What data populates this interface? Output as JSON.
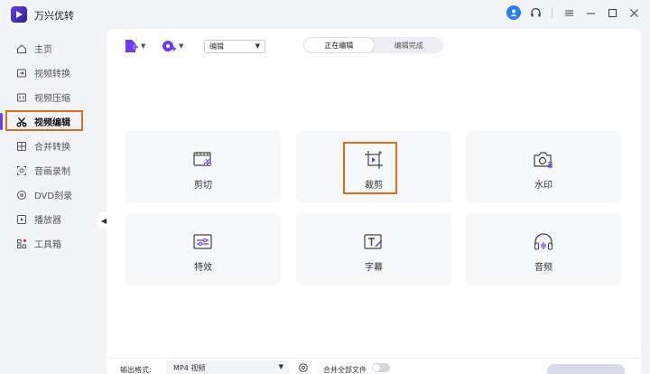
{
  "app": {
    "title": "万兴优转",
    "brand_color": "#6b3cf0",
    "icons": [
      "user-avatar-icon",
      "headset-icon",
      "menu-icon",
      "minimize-icon",
      "maximize-icon",
      "close-icon"
    ]
  },
  "sidebar": {
    "items": [
      {
        "label": "主页",
        "icon": "home-icon",
        "active": false
      },
      {
        "label": "视频转换",
        "icon": "convert-icon",
        "active": false
      },
      {
        "label": "视频压缩",
        "icon": "compress-icon",
        "active": false
      },
      {
        "label": "视频编辑",
        "icon": "scissors-icon",
        "active": true
      },
      {
        "label": "合并转换",
        "icon": "merge-icon",
        "active": false
      },
      {
        "label": "音画录制",
        "icon": "record-icon",
        "active": false
      },
      {
        "label": "DVD刻录",
        "icon": "disc-icon",
        "active": false
      },
      {
        "label": "播放器",
        "icon": "play-icon",
        "active": false
      },
      {
        "label": "工具箱",
        "icon": "toolbox-icon",
        "active": false
      }
    ],
    "highlight_color": "#d9701f"
  },
  "toolbar": {
    "mode_select": "编辑",
    "tabs": [
      {
        "label": "正在编辑",
        "active": true
      },
      {
        "label": "编辑完成",
        "active": false
      }
    ]
  },
  "tools": [
    {
      "label": "剪切",
      "icon": "trim-icon"
    },
    {
      "label": "裁剪",
      "icon": "crop-icon",
      "highlighted": true
    },
    {
      "label": "水印",
      "icon": "watermark-icon"
    },
    {
      "label": "特效",
      "icon": "effects-icon"
    },
    {
      "label": "字幕",
      "icon": "subtitle-icon"
    },
    {
      "label": "音频",
      "icon": "audio-icon"
    }
  ],
  "footer": {
    "output_format_label": "输出格式:",
    "output_format_value": "MP4 视频",
    "merge_all_label": "合并全部文件",
    "merge_all_enabled": false
  }
}
